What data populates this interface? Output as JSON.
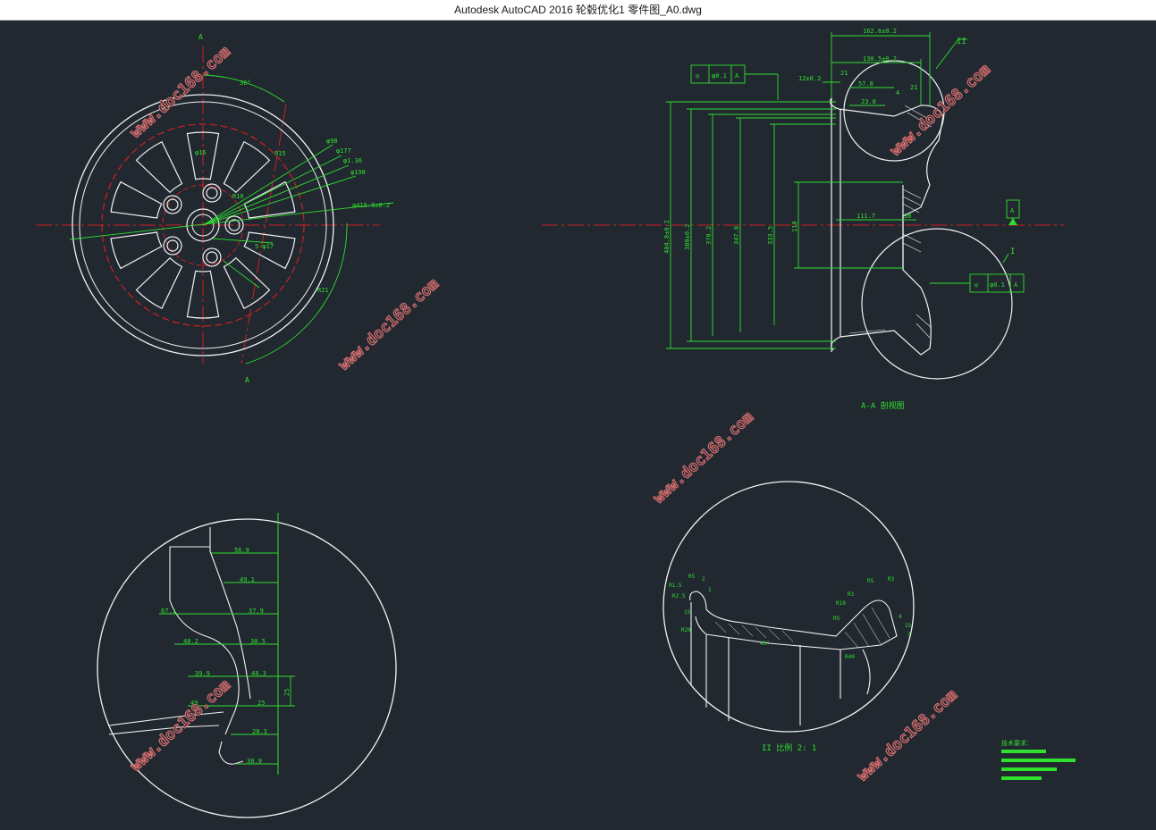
{
  "window": {
    "title": "Autodesk AutoCAD 2016     轮毂优化1 零件图_A0.dwg"
  },
  "drawing": {
    "front_view": {
      "section_letter_top": "A",
      "section_letter_bottom": "A",
      "angle_label": "36°",
      "diameters": [
        "φ98",
        "φ177",
        "φ1.36",
        "φ198",
        "φ415.8±0.2"
      ],
      "labels": {
        "r15": "R15",
        "d16": "φ16",
        "r10": "R10",
        "r21": "R21",
        "n5": "5-φ17"
      }
    },
    "section_view": {
      "caption": "A-A 剖视图",
      "detail_I": "I",
      "detail_II": "II",
      "datum": "A",
      "gdt_top": {
        "symbol": "◎",
        "value": "φ0.1",
        "datum": "A"
      },
      "gdt_right": {
        "symbol": "◎",
        "value": "φ0.1",
        "datum": "A"
      },
      "dims_top": [
        "162.6±0.2",
        "130.5±0.2",
        "12±0.2",
        "57.8",
        "23.8",
        "21",
        "4",
        "21"
      ],
      "dims_side": [
        "404.8±0.2",
        "380±0.2",
        "370.2",
        "347.8",
        "333.5",
        "110"
      ],
      "dims_mid": [
        "111.7",
        "30"
      ]
    },
    "detail_ii": {
      "caption": "II 比例 2: 1",
      "labels": [
        "R1.5",
        "R2.5",
        "R5",
        "2",
        "1",
        "15",
        "45°",
        "R20",
        "R10",
        "R3",
        "R5",
        "R40",
        "R3",
        "4",
        "R5",
        "15",
        "3"
      ]
    },
    "detail_i": {
      "dims": [
        "56.9",
        "49.1",
        "67.1",
        "37.9",
        "48.2",
        "30.5",
        "39.9",
        "48.3",
        "49",
        "25",
        "28.3",
        "30.9",
        "25"
      ]
    },
    "notes": {
      "title": "技术要求："
    },
    "watermark": "www.doc168.com"
  }
}
